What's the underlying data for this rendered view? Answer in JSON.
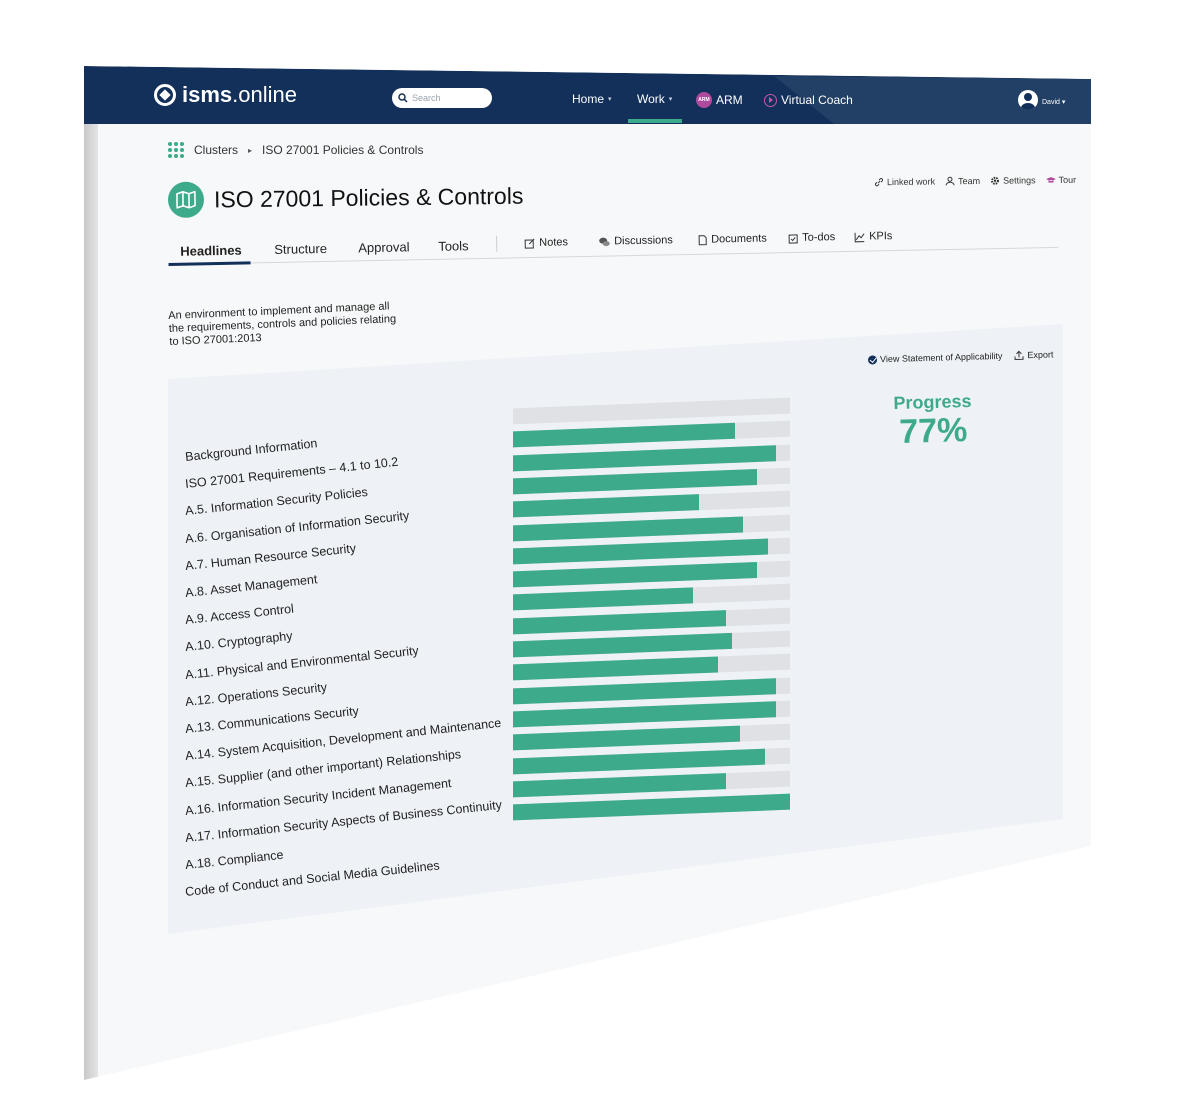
{
  "header": {
    "logo_prefix": "isms",
    "logo_suffix": ".online",
    "search_placeholder": "Search",
    "nav": [
      {
        "label": "Home",
        "caret": "▾"
      },
      {
        "label": "Work",
        "caret": "▾"
      },
      {
        "label": "ARM",
        "badge": "ARM"
      },
      {
        "label": "Virtual Coach"
      }
    ],
    "user": "David",
    "user_caret": "▾",
    "colors": {
      "bar": "#13305a",
      "accent": "#3daa8c",
      "arm": "#b04a9c"
    }
  },
  "breadcrumb": {
    "root": "Clusters",
    "separator": "▸",
    "current": "ISO 27001 Policies & Controls"
  },
  "page": {
    "title": "ISO 27001 Policies & Controls",
    "title_icon": "map-icon",
    "actions": [
      {
        "label": "Linked work",
        "icon": "link-icon"
      },
      {
        "label": "Team",
        "icon": "team-icon"
      },
      {
        "label": "Settings",
        "icon": "gear-icon"
      },
      {
        "label": "Tour",
        "icon": "graduation-cap-icon"
      }
    ],
    "tabs": [
      "Headlines",
      "Structure",
      "Approval",
      "Tools"
    ],
    "active_tab": "Headlines",
    "secondary_tabs": [
      {
        "label": "Notes",
        "icon": "notes-icon"
      },
      {
        "label": "Discussions",
        "icon": "discussions-icon"
      },
      {
        "label": "Documents",
        "icon": "document-icon"
      },
      {
        "label": "To-dos",
        "icon": "todo-icon"
      },
      {
        "label": "KPIs",
        "icon": "chart-icon"
      }
    ],
    "description_lines": [
      "An environment to implement and manage all",
      "the requirements, controls and policies relating",
      "to ISO 27001:2013"
    ]
  },
  "panel": {
    "soa_label": "View Statement of Applicability",
    "export_label": "Export",
    "progress_label": "Progress",
    "progress_value": "77%"
  },
  "chart_data": {
    "type": "bar",
    "orientation": "horizontal",
    "categories": [
      "Background Information",
      "ISO 27001 Requirements – 4.1 to 10.2",
      "A.5. Information Security Policies",
      "A.6. Organisation of Information Security",
      "A.7. Human Resource Security",
      "A.8. Asset Management",
      "A.9. Access Control",
      "A.10. Cryptography",
      "A.11. Physical and Environmental Security",
      "A.12. Operations Security",
      "A.13. Communications Security",
      "A.14. System Acquisition, Development and Maintenance",
      "A.15. Supplier (and other important) Relationships",
      "A.16. Information Security Incident Management",
      "A.17. Information Security Aspects of Business Continuity",
      "A.18. Compliance",
      "Code of Conduct and Social Media Guidelines"
    ],
    "values": [
      0,
      80,
      95,
      88,
      67,
      83,
      92,
      88,
      65,
      77,
      79,
      74,
      95,
      95,
      82,
      91,
      77,
      100
    ],
    "ylim": [
      0,
      100
    ]
  }
}
